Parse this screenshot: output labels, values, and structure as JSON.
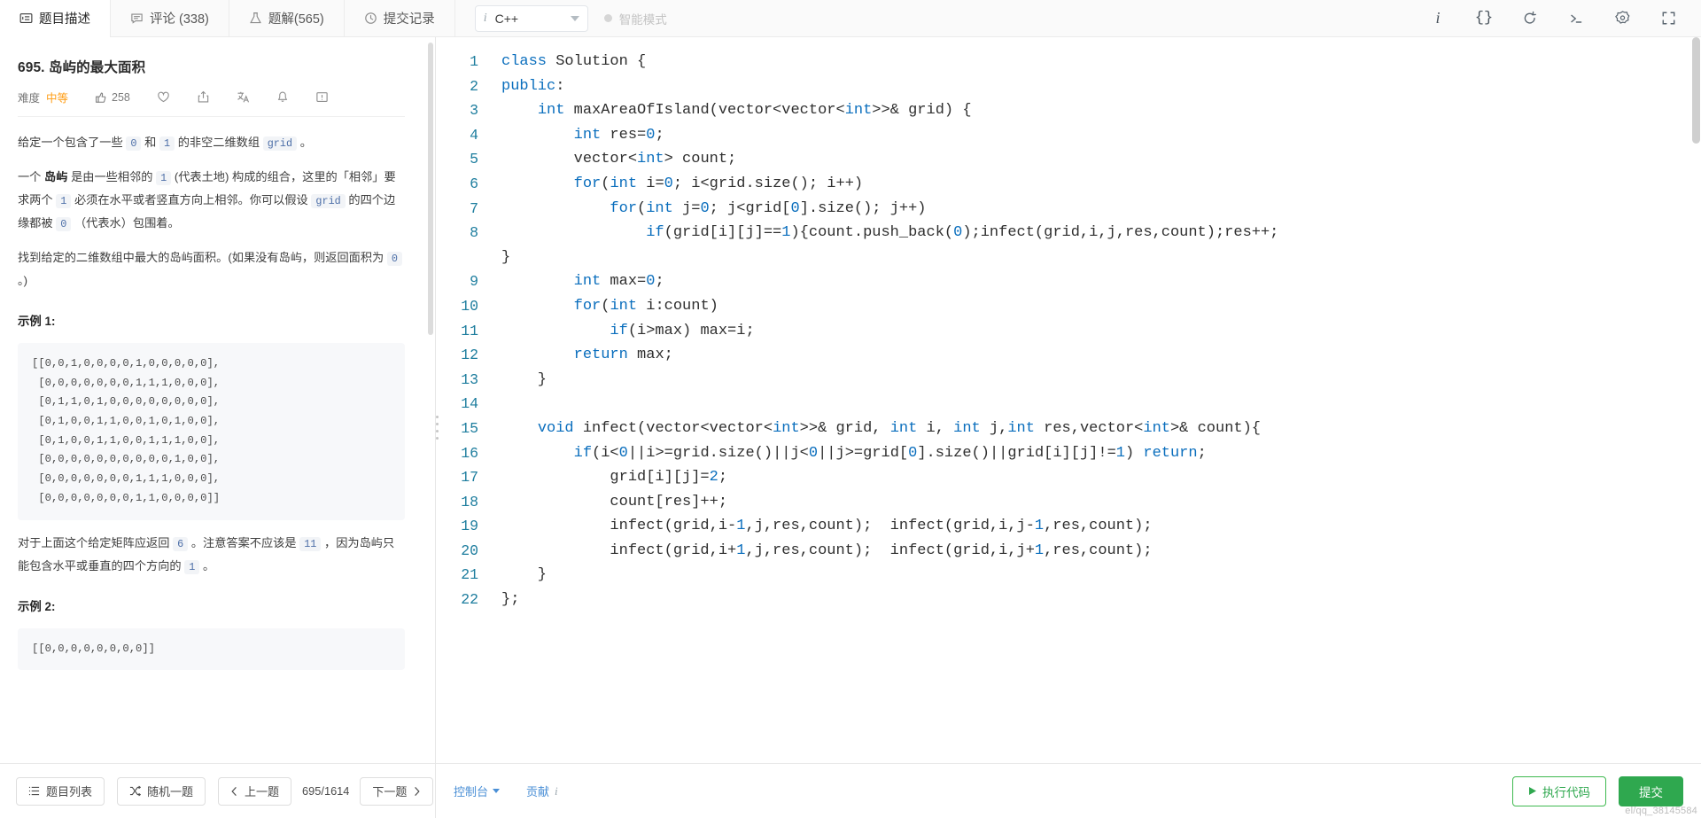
{
  "topbar": {
    "tabs": [
      {
        "label": "题目描述",
        "icon": "description-icon",
        "active": true
      },
      {
        "label": "评论 (338)",
        "icon": "comment-icon",
        "active": false
      },
      {
        "label": "题解(565)",
        "icon": "flask-icon",
        "active": false
      },
      {
        "label": "提交记录",
        "icon": "clock-icon",
        "active": false
      }
    ],
    "language": {
      "value": "C++",
      "info_glyph": "i"
    },
    "smart_mode": {
      "label": "智能模式"
    },
    "tools": [
      {
        "name": "info-icon",
        "glyph": "i"
      },
      {
        "name": "format-braces-icon",
        "glyph": "{}"
      },
      {
        "name": "reset-icon",
        "glyph": "↺"
      },
      {
        "name": "console-icon",
        "glyph": ">_"
      },
      {
        "name": "settings-gear-icon",
        "glyph": "⚙"
      },
      {
        "name": "fullscreen-icon",
        "glyph": "⛶"
      }
    ]
  },
  "problem": {
    "title": "695. 岛屿的最大面积",
    "difficulty_label": "难度",
    "difficulty_value": "中等",
    "difficulty_color": "#ff9d14",
    "likes": "258",
    "actions": [
      "thumbs-up-icon",
      "heart-icon",
      "share-icon",
      "translate-icon",
      "bell-icon",
      "feedback-icon"
    ],
    "paragraphs": [
      {
        "id": "p1",
        "parts": [
          {
            "t": "text",
            "v": "给定一个包含了一些 "
          },
          {
            "t": "code",
            "v": "0"
          },
          {
            "t": "text",
            "v": " 和 "
          },
          {
            "t": "code",
            "v": "1"
          },
          {
            "t": "text",
            "v": " 的非空二维数组 "
          },
          {
            "t": "code",
            "v": "grid"
          },
          {
            "t": "text",
            "v": " 。"
          }
        ]
      },
      {
        "id": "p2",
        "parts": [
          {
            "t": "text",
            "v": "一个 "
          },
          {
            "t": "bold",
            "v": "岛屿"
          },
          {
            "t": "text",
            "v": " 是由一些相邻的 "
          },
          {
            "t": "code",
            "v": "1"
          },
          {
            "t": "text",
            "v": " (代表土地) 构成的组合，这里的「相邻」要求两个 "
          },
          {
            "t": "code",
            "v": "1"
          },
          {
            "t": "text",
            "v": " 必须在水平或者竖直方向上相邻。你可以假设 "
          },
          {
            "t": "code",
            "v": "grid"
          },
          {
            "t": "text",
            "v": " 的四个边缘都被 "
          },
          {
            "t": "code",
            "v": "0"
          },
          {
            "t": "text",
            "v": " （代表水）包围着。"
          }
        ]
      },
      {
        "id": "p3",
        "parts": [
          {
            "t": "text",
            "v": "找到给定的二维数组中最大的岛屿面积。(如果没有岛屿，则返回面积为 "
          },
          {
            "t": "code",
            "v": "0"
          },
          {
            "t": "text",
            "v": " 。)"
          }
        ]
      }
    ],
    "example1_heading": "示例 1:",
    "example1_code": "[[0,0,1,0,0,0,0,1,0,0,0,0,0],\n [0,0,0,0,0,0,0,1,1,1,0,0,0],\n [0,1,1,0,1,0,0,0,0,0,0,0,0],\n [0,1,0,0,1,1,0,0,1,0,1,0,0],\n [0,1,0,0,1,1,0,0,1,1,1,0,0],\n [0,0,0,0,0,0,0,0,0,0,1,0,0],\n [0,0,0,0,0,0,0,1,1,1,0,0,0],\n [0,0,0,0,0,0,0,1,1,0,0,0,0]]",
    "example1_note": {
      "parts": [
        {
          "t": "text",
          "v": "对于上面这个给定矩阵应返回 "
        },
        {
          "t": "code",
          "v": "6"
        },
        {
          "t": "text",
          "v": " 。注意答案不应该是 "
        },
        {
          "t": "code",
          "v": "11"
        },
        {
          "t": "text",
          "v": " ，因为岛屿只能包含水平或垂直的四个方向的 "
        },
        {
          "t": "code",
          "v": "1"
        },
        {
          "t": "text",
          "v": " 。"
        }
      ]
    },
    "example2_heading": "示例 2:",
    "example2_code": "[[0,0,0,0,0,0,0,0]]"
  },
  "left_footer": {
    "problem_list": "题目列表",
    "random": "随机一题",
    "prev": "上一题",
    "counter": "695/1614",
    "next": "下一题"
  },
  "right_footer": {
    "console": "控制台",
    "contribute": "贡献",
    "contribute_glyph": "i",
    "run": "执行代码",
    "submit": "提交",
    "watermark": "el/qq_38145584"
  },
  "editor": {
    "lines": [
      {
        "n": 1,
        "tokens": [
          {
            "t": "kw",
            "v": "class"
          },
          {
            "t": "p",
            "v": " Solution {"
          }
        ]
      },
      {
        "n": 2,
        "tokens": [
          {
            "t": "kw",
            "v": "public"
          },
          {
            "t": "p",
            "v": ":"
          }
        ]
      },
      {
        "n": 3,
        "tokens": [
          {
            "t": "p",
            "v": "    "
          },
          {
            "t": "ty",
            "v": "int"
          },
          {
            "t": "p",
            "v": " maxAreaOfIsland(vector<vector<"
          },
          {
            "t": "ty",
            "v": "int"
          },
          {
            "t": "p",
            "v": ">>& grid) {"
          }
        ]
      },
      {
        "n": 4,
        "tokens": [
          {
            "t": "p",
            "v": "        "
          },
          {
            "t": "ty",
            "v": "int"
          },
          {
            "t": "p",
            "v": " res="
          },
          {
            "t": "num",
            "v": "0"
          },
          {
            "t": "p",
            "v": ";"
          }
        ]
      },
      {
        "n": 5,
        "tokens": [
          {
            "t": "p",
            "v": "        vector<"
          },
          {
            "t": "ty",
            "v": "int"
          },
          {
            "t": "p",
            "v": "> count;"
          }
        ]
      },
      {
        "n": 6,
        "tokens": [
          {
            "t": "p",
            "v": "        "
          },
          {
            "t": "kw",
            "v": "for"
          },
          {
            "t": "p",
            "v": "("
          },
          {
            "t": "ty",
            "v": "int"
          },
          {
            "t": "p",
            "v": " i="
          },
          {
            "t": "num",
            "v": "0"
          },
          {
            "t": "p",
            "v": "; i<grid.size(); i++)"
          }
        ]
      },
      {
        "n": 7,
        "tokens": [
          {
            "t": "p",
            "v": "            "
          },
          {
            "t": "kw",
            "v": "for"
          },
          {
            "t": "p",
            "v": "("
          },
          {
            "t": "ty",
            "v": "int"
          },
          {
            "t": "p",
            "v": " j="
          },
          {
            "t": "num",
            "v": "0"
          },
          {
            "t": "p",
            "v": "; j<grid["
          },
          {
            "t": "num",
            "v": "0"
          },
          {
            "t": "p",
            "v": "].size(); j++)"
          }
        ]
      },
      {
        "n": 8,
        "tokens": [
          {
            "t": "p",
            "v": "                "
          },
          {
            "t": "kw",
            "v": "if"
          },
          {
            "t": "p",
            "v": "(grid[i][j]=="
          },
          {
            "t": "num",
            "v": "1"
          },
          {
            "t": "p",
            "v": "){count.push_back("
          },
          {
            "t": "num",
            "v": "0"
          },
          {
            "t": "p",
            "v": ");infect(grid,i,j,res,count);res++;"
          }
        ]
      },
      {
        "n": "",
        "tokens": [
          {
            "t": "p",
            "v": "}"
          }
        ]
      },
      {
        "n": 9,
        "tokens": [
          {
            "t": "p",
            "v": "        "
          },
          {
            "t": "ty",
            "v": "int"
          },
          {
            "t": "p",
            "v": " max="
          },
          {
            "t": "num",
            "v": "0"
          },
          {
            "t": "p",
            "v": ";"
          }
        ]
      },
      {
        "n": 10,
        "tokens": [
          {
            "t": "p",
            "v": "        "
          },
          {
            "t": "kw",
            "v": "for"
          },
          {
            "t": "p",
            "v": "("
          },
          {
            "t": "ty",
            "v": "int"
          },
          {
            "t": "p",
            "v": " i:count)"
          }
        ]
      },
      {
        "n": 11,
        "tokens": [
          {
            "t": "p",
            "v": "            "
          },
          {
            "t": "kw",
            "v": "if"
          },
          {
            "t": "p",
            "v": "(i>max) max=i;"
          }
        ]
      },
      {
        "n": 12,
        "tokens": [
          {
            "t": "p",
            "v": "        "
          },
          {
            "t": "kw",
            "v": "return"
          },
          {
            "t": "p",
            "v": " max;"
          }
        ]
      },
      {
        "n": 13,
        "tokens": [
          {
            "t": "p",
            "v": "    }"
          }
        ]
      },
      {
        "n": 14,
        "tokens": [
          {
            "t": "p",
            "v": ""
          }
        ]
      },
      {
        "n": 15,
        "tokens": [
          {
            "t": "p",
            "v": "    "
          },
          {
            "t": "kw",
            "v": "void"
          },
          {
            "t": "p",
            "v": " infect(vector<vector<"
          },
          {
            "t": "ty",
            "v": "int"
          },
          {
            "t": "p",
            "v": ">>& grid, "
          },
          {
            "t": "ty",
            "v": "int"
          },
          {
            "t": "p",
            "v": " i, "
          },
          {
            "t": "ty",
            "v": "int"
          },
          {
            "t": "p",
            "v": " j,"
          },
          {
            "t": "ty",
            "v": "int"
          },
          {
            "t": "p",
            "v": " res,vector<"
          },
          {
            "t": "ty",
            "v": "int"
          },
          {
            "t": "p",
            "v": ">& count){"
          }
        ]
      },
      {
        "n": 16,
        "tokens": [
          {
            "t": "p",
            "v": "        "
          },
          {
            "t": "kw",
            "v": "if"
          },
          {
            "t": "p",
            "v": "(i<"
          },
          {
            "t": "num",
            "v": "0"
          },
          {
            "t": "p",
            "v": "||i>=grid.size()||j<"
          },
          {
            "t": "num",
            "v": "0"
          },
          {
            "t": "p",
            "v": "||j>=grid["
          },
          {
            "t": "num",
            "v": "0"
          },
          {
            "t": "p",
            "v": "].size()||grid[i][j]!="
          },
          {
            "t": "num",
            "v": "1"
          },
          {
            "t": "p",
            "v": ") "
          },
          {
            "t": "kw",
            "v": "return"
          },
          {
            "t": "p",
            "v": ";"
          }
        ]
      },
      {
        "n": 17,
        "tokens": [
          {
            "t": "p",
            "v": "            grid[i][j]="
          },
          {
            "t": "num",
            "v": "2"
          },
          {
            "t": "p",
            "v": ";"
          }
        ]
      },
      {
        "n": 18,
        "tokens": [
          {
            "t": "p",
            "v": "            count[res]++;"
          }
        ]
      },
      {
        "n": 19,
        "tokens": [
          {
            "t": "p",
            "v": "            infect(grid,i-"
          },
          {
            "t": "num",
            "v": "1"
          },
          {
            "t": "p",
            "v": ",j,res,count);  infect(grid,i,j-"
          },
          {
            "t": "num",
            "v": "1"
          },
          {
            "t": "p",
            "v": ",res,count);"
          }
        ]
      },
      {
        "n": 20,
        "tokens": [
          {
            "t": "p",
            "v": "            infect(grid,i+"
          },
          {
            "t": "num",
            "v": "1"
          },
          {
            "t": "p",
            "v": ",j,res,count);  infect(grid,i,j+"
          },
          {
            "t": "num",
            "v": "1"
          },
          {
            "t": "p",
            "v": ",res,count);"
          }
        ]
      },
      {
        "n": 21,
        "tokens": [
          {
            "t": "p",
            "v": "    }"
          }
        ]
      },
      {
        "n": 22,
        "tokens": [
          {
            "t": "p",
            "v": "};"
          }
        ]
      }
    ]
  }
}
